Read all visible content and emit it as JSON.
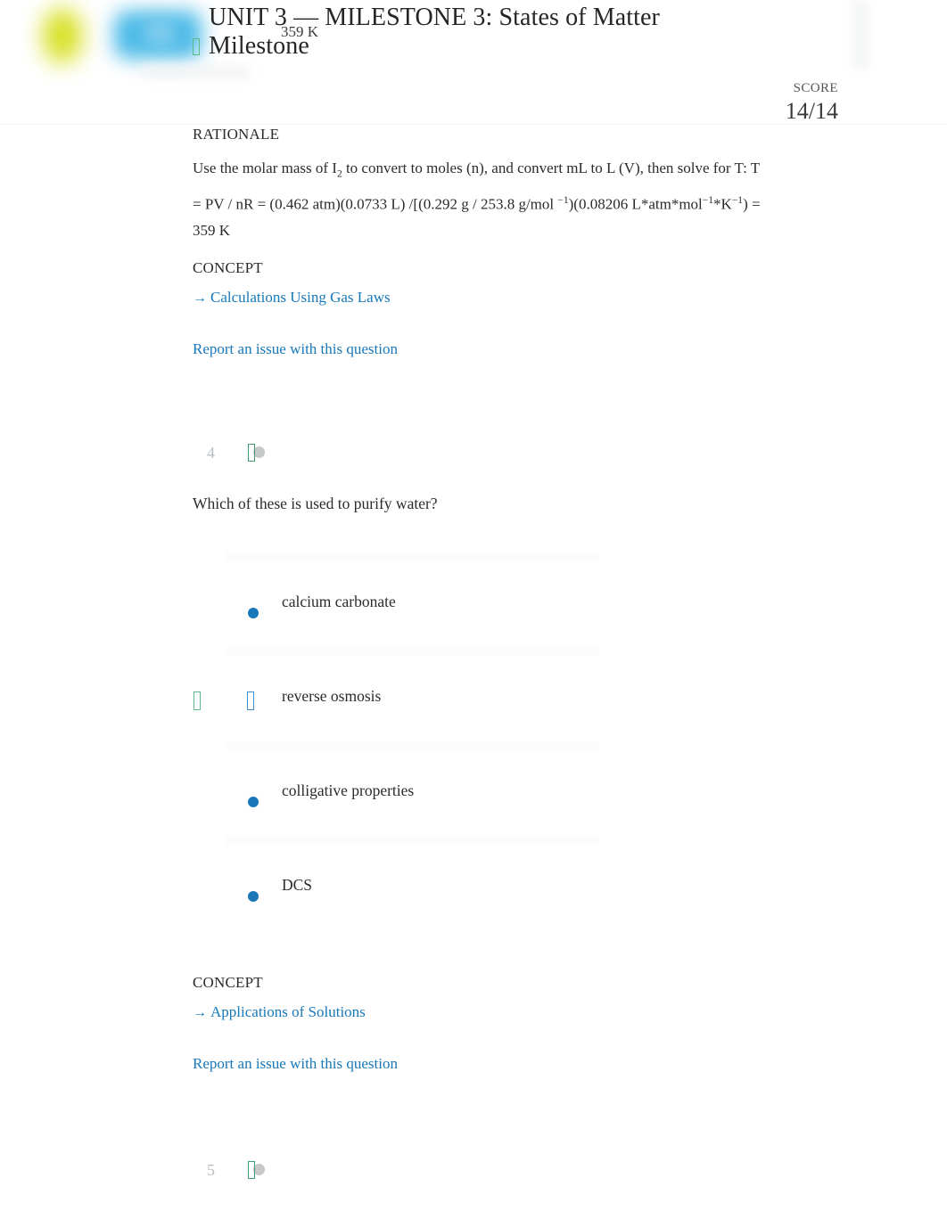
{
  "header": {
    "title": "UNIT 3 — MILESTONE 3: States of Matter Milestone",
    "overlay_answer": "359 K",
    "score_label": "SCORE",
    "score_value": "14/14",
    "logo_icon": "sophia-logo",
    "accent_blue": "#1878b8",
    "accent_green": "#5bb98c",
    "logo_yellow": "#d4de12",
    "logo_blue": "#41b6e6"
  },
  "rationale": {
    "label": "RATIONALE",
    "line1_a": "Use the molar mass of I",
    "line1_sub": "2",
    "line1_b": " to convert to moles (n), and convert mL to L (V), then solve for T: T = PV / nR = (0.462 atm)(0.0733 L) /[(0.292 g / 253.8 g/mol ",
    "sup1": "−1",
    "line1_c": ")(0.08206 L*atm*mol",
    "sup2": "−1",
    "line1_d": "*K",
    "sup3": "−1",
    "line1_e": ") = 359 K"
  },
  "concept_top": {
    "label": "CONCEPT",
    "arrow": "→",
    "link": "Calculations Using Gas Laws",
    "report_link": "Report an issue with this question"
  },
  "question4": {
    "number": "4",
    "text": "Which of these is used to purify water?",
    "options": [
      {
        "label": "calcium carbonate",
        "selected": false,
        "correct": false
      },
      {
        "label": "reverse osmosis",
        "selected": true,
        "correct": true
      },
      {
        "label": "colligative properties",
        "selected": false,
        "correct": false
      },
      {
        "label": "DCS",
        "selected": false,
        "correct": false
      }
    ]
  },
  "concept_bottom": {
    "label": "CONCEPT",
    "arrow": "→",
    "link": "Applications of Solutions",
    "report_link": "Report an issue with this question"
  },
  "question5": {
    "number": "5"
  }
}
